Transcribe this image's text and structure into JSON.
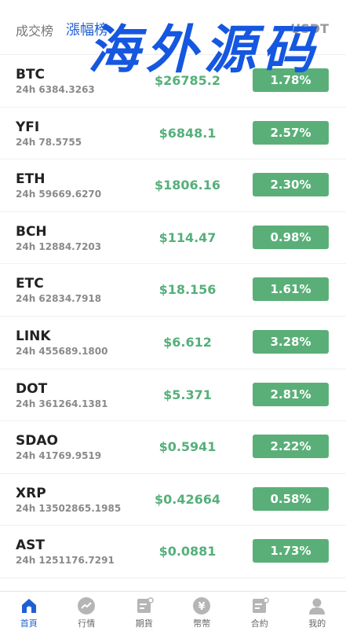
{
  "header": {
    "tab_volume": "成交榜",
    "tab_gainers": "漲幅榜",
    "currency": "USDT",
    "watermark": "海外源码"
  },
  "rows": [
    {
      "symbol": "BTC",
      "volume": "24h 6384.3263",
      "price": "$26785.2",
      "change": "1.78%"
    },
    {
      "symbol": "YFI",
      "volume": "24h 78.5755",
      "price": "$6848.1",
      "change": "2.57%"
    },
    {
      "symbol": "ETH",
      "volume": "24h 59669.6270",
      "price": "$1806.16",
      "change": "2.30%"
    },
    {
      "symbol": "BCH",
      "volume": "24h 12884.7203",
      "price": "$114.47",
      "change": "0.98%"
    },
    {
      "symbol": "ETC",
      "volume": "24h 62834.7918",
      "price": "$18.156",
      "change": "1.61%"
    },
    {
      "symbol": "LINK",
      "volume": "24h 455689.1800",
      "price": "$6.612",
      "change": "3.28%"
    },
    {
      "symbol": "DOT",
      "volume": "24h 361264.1381",
      "price": "$5.371",
      "change": "2.81%"
    },
    {
      "symbol": "SDAO",
      "volume": "24h 41769.9519",
      "price": "$0.5941",
      "change": "2.22%"
    },
    {
      "symbol": "XRP",
      "volume": "24h 13502865.1985",
      "price": "$0.42664",
      "change": "0.58%"
    },
    {
      "symbol": "AST",
      "volume": "24h 1251176.7291",
      "price": "$0.0881",
      "change": "1.73%"
    }
  ],
  "tabbar": [
    {
      "label": "首頁",
      "icon": "home-icon"
    },
    {
      "label": "行情",
      "icon": "market-icon"
    },
    {
      "label": "期貨",
      "icon": "futures-icon"
    },
    {
      "label": "幣幣",
      "icon": "coin-icon"
    },
    {
      "label": "合約",
      "icon": "contract-icon"
    },
    {
      "label": "我的",
      "icon": "profile-icon"
    }
  ],
  "colors": {
    "accent": "#1f5fd6",
    "up": "#5aaf78",
    "price": "#55b07a",
    "watermark": "#1557e0"
  }
}
